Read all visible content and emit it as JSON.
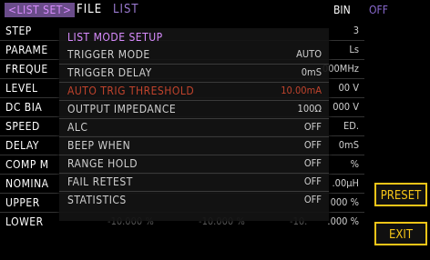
{
  "topbar": {
    "list_tab": "<LIST SET>",
    "file_tab": "FILE",
    "list_word": "LIST",
    "bin_label": "BIN",
    "bin_value": "OFF"
  },
  "background_rows": [
    {
      "label": "STEP",
      "value": "3"
    },
    {
      "label": "PARAME",
      "value": "Ls"
    },
    {
      "label": "FREQUE",
      "value": "000MHz"
    },
    {
      "label": "LEVEL",
      "value": "00 V"
    },
    {
      "label": "DC BIA",
      "value": "000 V"
    },
    {
      "label": "SPEED",
      "value": "ED."
    },
    {
      "label": "DELAY",
      "value": "0mS"
    },
    {
      "label": "COMP M",
      "value": "%"
    },
    {
      "label": "NOMINA",
      "value": ".00μH"
    },
    {
      "label": "UPPER",
      "value": "000 %"
    },
    {
      "label": "LOWER",
      "value": ".000 %"
    }
  ],
  "lower_values": [
    "-10.000 %",
    "-10.000 %",
    "-10."
  ],
  "buttons": {
    "preset": "PRESET",
    "exit": "EXIT"
  },
  "modal": {
    "title": "LIST MODE SETUP",
    "items": [
      {
        "label": "TRIGGER MODE",
        "value": "AUTO"
      },
      {
        "label": "TRIGGER DELAY",
        "value": "0mS"
      },
      {
        "label": "AUTO TRIG THRESHOLD",
        "value": "10.00mA"
      },
      {
        "label": "OUTPUT IMPEDANCE",
        "value": "100Ω"
      },
      {
        "label": "ALC",
        "value": "OFF"
      },
      {
        "label": "BEEP WHEN",
        "value": "OFF"
      },
      {
        "label": "RANGE HOLD",
        "value": "OFF"
      },
      {
        "label": "FAIL RETEST",
        "value": "OFF"
      },
      {
        "label": "STATISTICS",
        "value": "OFF"
      }
    ]
  },
  "colors": {
    "accent": "#f5c518",
    "tab_bg": "#6a4c8a",
    "warn": "#c0432c"
  }
}
